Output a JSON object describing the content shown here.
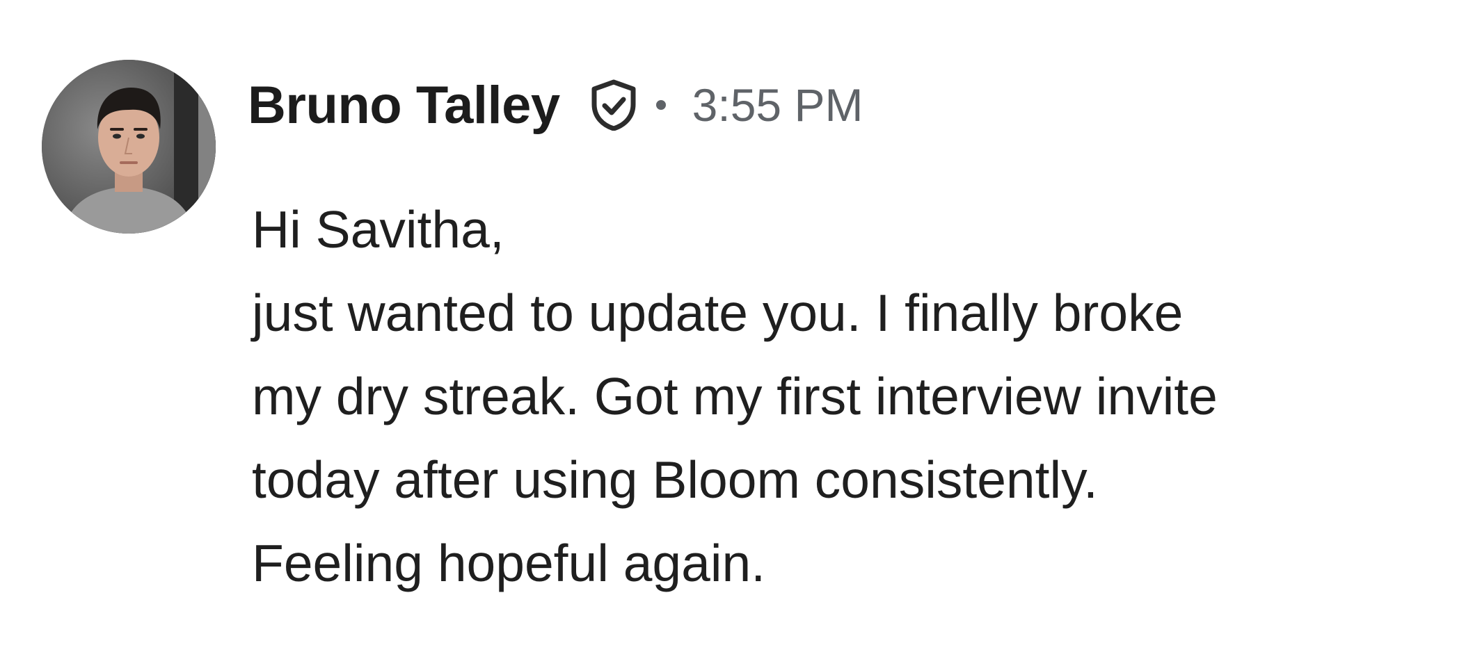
{
  "message": {
    "author": {
      "name": "Bruno Talley",
      "avatar_icon": "avatar-photo",
      "verified_icon": "shield-check-icon"
    },
    "timestamp": "3:55 PM",
    "body_lines": [
      "Hi Savitha,",
      "just wanted to update you. I finally broke",
      "my dry streak. Got my first interview invite",
      "today after using Bloom consistently.",
      "Feeling hopeful again."
    ]
  },
  "colors": {
    "text_primary": "#1f1f1f",
    "text_secondary": "#5f6368",
    "background": "#ffffff"
  }
}
